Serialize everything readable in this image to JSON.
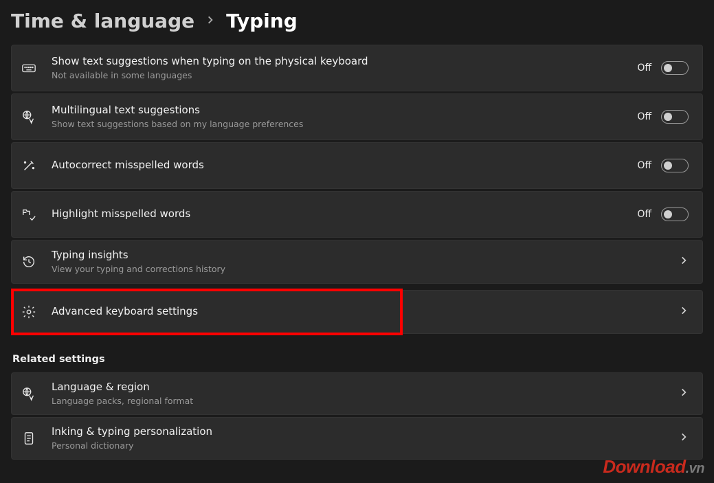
{
  "breadcrumb": {
    "parent": "Time & language",
    "current": "Typing"
  },
  "off_label": "Off",
  "items": [
    {
      "title": "Show text suggestions when typing on the physical keyboard",
      "subtitle": "Not available in some languages",
      "kind": "toggle"
    },
    {
      "title": "Multilingual text suggestions",
      "subtitle": "Show text suggestions based on my language preferences",
      "kind": "toggle"
    },
    {
      "title": "Autocorrect misspelled words",
      "subtitle": "",
      "kind": "toggle"
    },
    {
      "title": "Highlight misspelled words",
      "subtitle": "",
      "kind": "toggle"
    },
    {
      "title": "Typing insights",
      "subtitle": "View your typing and corrections history",
      "kind": "nav"
    },
    {
      "title": "Advanced keyboard settings",
      "subtitle": "",
      "kind": "nav",
      "highlighted": true
    }
  ],
  "related_header": "Related settings",
  "related": [
    {
      "title": "Language & region",
      "subtitle": "Language packs, regional format"
    },
    {
      "title": "Inking & typing personalization",
      "subtitle": "Personal dictionary"
    }
  ],
  "watermark": {
    "main": "Download",
    "suffix": ".vn"
  }
}
